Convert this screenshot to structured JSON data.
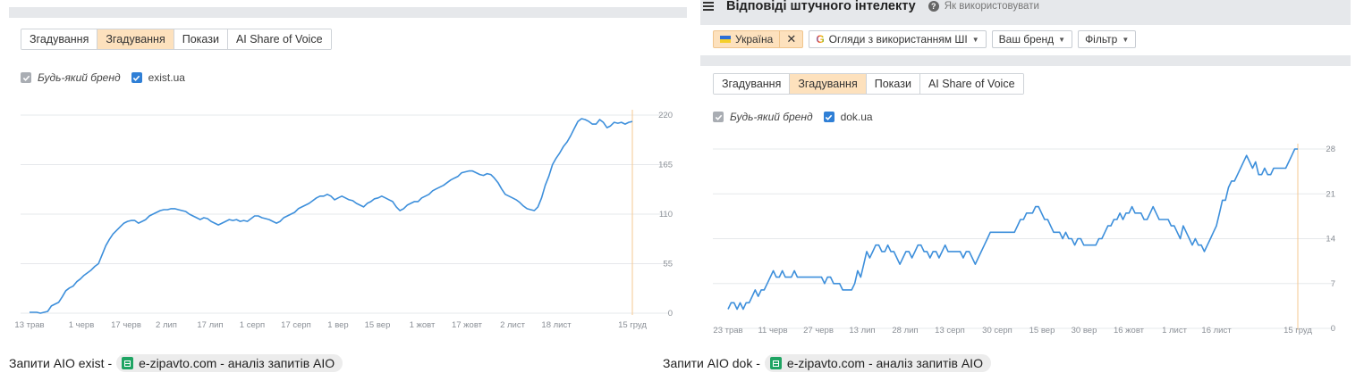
{
  "left": {
    "tabs": [
      {
        "label": "Згадування",
        "active": false
      },
      {
        "label": "Згадування",
        "active": true
      },
      {
        "label": "Покази",
        "active": false
      },
      {
        "label": "AI Share of Voice",
        "active": false
      }
    ],
    "legend": {
      "any_brand": "Будь-який бренд",
      "brand": "exist.ua"
    },
    "caption": {
      "prefix": "Запити AIO exist -",
      "chip": "e-zipavto.com - аналіз запитів AIO"
    }
  },
  "right": {
    "header": {
      "title": "Відповіді штучного інтелекту",
      "help": "Як використовувати"
    },
    "filters": {
      "country": "Україна",
      "source": "Огляди з використанням ШІ",
      "brand": "Ваш бренд",
      "filter": "Фільтр"
    },
    "tabs": [
      {
        "label": "Згадування",
        "active": false
      },
      {
        "label": "Згадування",
        "active": true
      },
      {
        "label": "Покази",
        "active": false
      },
      {
        "label": "AI Share of Voice",
        "active": false
      }
    ],
    "legend": {
      "any_brand": "Будь-який бренд",
      "brand": "dok.ua"
    },
    "caption": {
      "prefix": "Запити AIO dok -",
      "chip": "e-zipavto.com - аналіз запитів AIO"
    }
  },
  "colors": {
    "line": "#3d8fdb",
    "marker_line": "#f5c892",
    "grid": "#e6e8eb",
    "active_tab": "#fde1bd"
  },
  "chart_data": [
    {
      "type": "line",
      "x_ticks": [
        "13 трав",
        "1 черв",
        "17 черв",
        "2 лип",
        "17 лип",
        "1 серп",
        "17 серп",
        "1 вер",
        "15 вер",
        "1 жовт",
        "17 жовт",
        "2 лист",
        "18 лист",
        "15 груд"
      ],
      "y_ticks": [
        "220",
        "165",
        "110",
        "55",
        "0"
      ],
      "ylim": [
        0,
        220
      ],
      "series": [
        {
          "values": [
            1,
            1,
            1,
            0,
            1,
            2,
            8,
            10,
            12,
            18,
            25,
            28,
            30,
            35,
            38,
            42,
            45,
            48,
            52,
            55,
            65,
            75,
            82,
            88,
            92,
            96,
            100,
            102,
            103,
            103,
            100,
            102,
            104,
            108,
            110,
            112,
            114,
            115,
            115,
            116,
            116,
            115,
            114,
            113,
            110,
            108,
            106,
            104,
            106,
            105,
            102,
            100,
            98,
            100,
            102,
            104,
            103,
            104,
            102,
            103,
            102,
            105,
            108,
            108,
            106,
            105,
            104,
            102,
            100,
            102,
            106,
            108,
            110,
            112,
            116,
            118,
            120,
            122,
            125,
            128,
            130,
            130,
            132,
            130,
            126,
            128,
            130,
            128,
            126,
            125,
            122,
            120,
            118,
            122,
            124,
            127,
            128,
            130,
            128,
            126,
            124,
            118,
            114,
            116,
            120,
            122,
            124,
            124,
            128,
            130,
            132,
            136,
            138,
            140,
            142,
            145,
            148,
            150,
            152,
            156,
            157,
            158,
            158,
            156,
            154,
            153,
            155,
            154,
            150,
            145,
            138,
            132,
            130,
            128,
            126,
            123,
            119,
            116,
            115,
            114,
            118,
            128,
            142,
            152,
            165,
            172,
            178,
            185,
            190,
            197,
            205,
            213,
            216,
            215,
            213,
            210,
            210,
            215,
            212,
            206,
            208,
            212,
            211,
            212,
            210,
            212,
            213
          ],
          "note_unused": ""
        }
      ]
    },
    {
      "type": "line",
      "x_ticks": [
        "23 трав",
        "11 черв",
        "27 черв",
        "13 лип",
        "28 лип",
        "13 серп",
        "30 серп",
        "15 вер",
        "30 вер",
        "16 жовт",
        "1 лист",
        "16 лист",
        "15 груд"
      ],
      "y_ticks": [
        "28",
        "21",
        "14",
        "7",
        "0"
      ],
      "ylim": [
        0,
        28
      ],
      "series": [
        {
          "values": [
            3,
            4,
            4,
            3,
            4,
            3,
            4,
            4,
            5,
            6,
            5,
            6,
            6,
            7,
            8,
            9,
            8,
            8,
            9,
            8,
            8,
            8,
            9,
            8,
            8,
            8,
            8,
            8,
            8,
            8,
            8,
            8,
            7,
            8,
            8,
            7,
            7,
            7,
            6,
            6,
            6,
            6,
            7,
            9,
            8,
            10,
            12,
            11,
            12,
            13,
            13,
            12,
            12,
            13,
            12,
            12,
            11,
            10,
            11,
            12,
            12,
            11,
            12,
            13,
            13,
            12,
            12,
            11,
            12,
            12,
            11,
            12,
            13,
            12,
            12,
            12,
            12,
            12,
            11,
            12,
            12,
            11,
            10,
            11,
            12,
            13,
            14,
            15,
            15,
            15,
            15,
            15,
            15,
            15,
            15,
            15,
            16,
            17,
            17,
            18,
            18,
            18,
            19,
            19,
            18,
            17,
            17,
            16,
            15,
            15,
            15,
            14,
            15,
            14,
            14,
            13,
            14,
            14,
            13,
            13,
            13,
            13,
            13,
            14,
            14,
            15,
            16,
            16,
            17,
            17,
            18,
            17,
            18,
            18,
            19,
            18,
            18,
            18,
            17,
            17,
            18,
            19,
            18,
            17,
            17,
            17,
            17,
            16,
            16,
            15,
            14,
            16,
            15,
            14,
            13,
            14,
            13,
            13,
            12,
            13,
            14,
            15,
            16,
            18,
            20,
            20,
            22,
            23,
            23,
            24,
            25,
            26,
            27,
            26,
            25,
            26,
            24,
            24,
            25,
            24,
            24,
            25,
            25,
            25,
            25,
            25,
            26,
            27,
            28,
            28
          ],
          "note_unused": ""
        }
      ]
    }
  ]
}
